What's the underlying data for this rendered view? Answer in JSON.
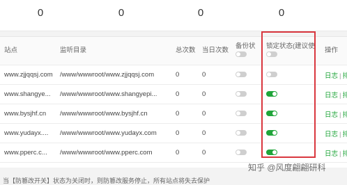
{
  "stats": {
    "values": [
      "0",
      "0",
      "0",
      "0"
    ]
  },
  "table": {
    "headers": {
      "site": "站点",
      "dir": "监听目录",
      "total": "总次数",
      "today": "当日次数",
      "backup": "备份状",
      "lock": "锁定状态(建议使",
      "ops": "操作"
    },
    "rows": [
      {
        "site": "www.zjjqqsj.com",
        "dir": "/www/wwwroot/www.zjjqqsj.com",
        "total": "0",
        "today": "0",
        "backup": "off",
        "lock": "off"
      },
      {
        "site": "www.shangye...",
        "dir": "/www/wwwroot/www.shangyepi...",
        "total": "0",
        "today": "0",
        "backup": "off",
        "lock": "on"
      },
      {
        "site": "www.bysjhf.cn",
        "dir": "/www/wwwroot/www.bysjhf.cn",
        "total": "0",
        "today": "0",
        "backup": "off",
        "lock": "on"
      },
      {
        "site": "www.yudayx....",
        "dir": "/www/wwwroot/www.yudayx.com",
        "total": "0",
        "today": "0",
        "backup": "off",
        "lock": "on"
      },
      {
        "site": "www.pperc.c...",
        "dir": "/www/wwwroot/www.pperc.com",
        "total": "0",
        "today": "0",
        "backup": "off",
        "lock": "on"
      }
    ],
    "op_log": "日志",
    "op_sep": "|",
    "op_more": "排"
  },
  "footer": {
    "note": "当【防篡改开关】状态为关闭时，则防篡改服务停止，所有站点将失去保护"
  },
  "watermark": {
    "text": "知乎 @风度翩翩研科"
  },
  "colors": {
    "accent": "#20a53a",
    "highlight": "#d9363e"
  }
}
